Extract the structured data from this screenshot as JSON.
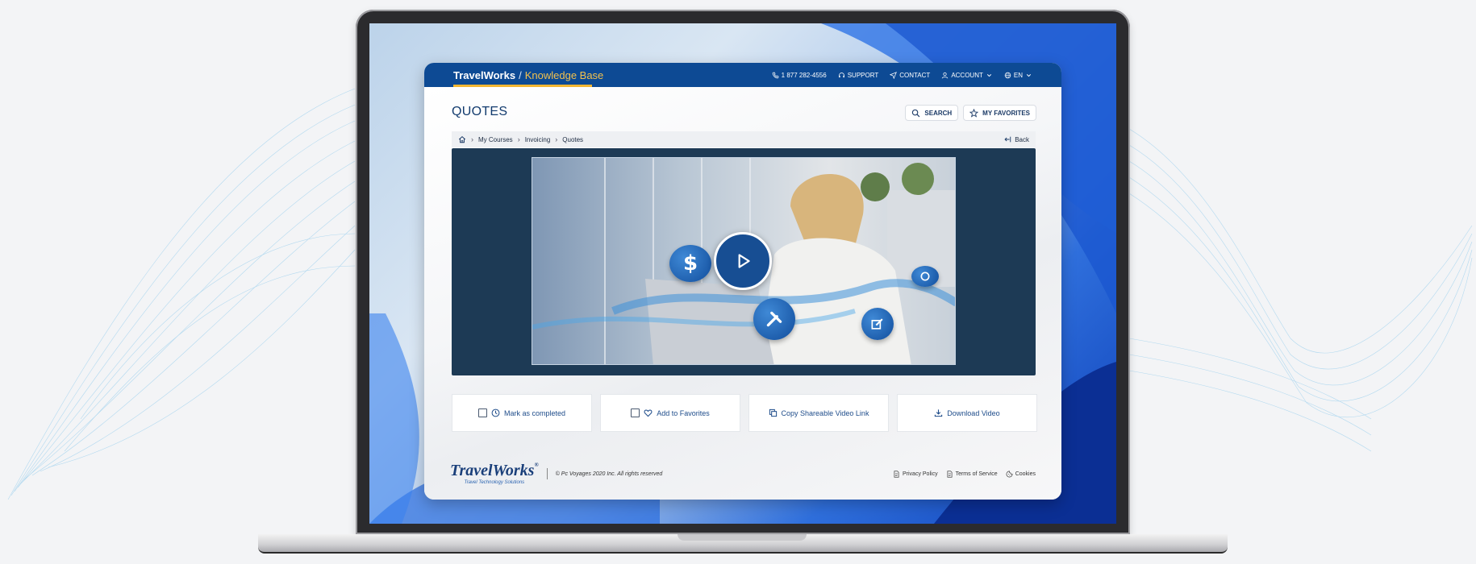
{
  "brand": {
    "name": "TravelWorks",
    "separator": "/",
    "section": "Knowledge Base"
  },
  "topnav": {
    "phone": "1 877 282-4556",
    "support": "SUPPORT",
    "contact": "CONTACT",
    "account": "ACCOUNT",
    "language": "EN"
  },
  "page": {
    "title": "QUOTES"
  },
  "actions": {
    "search": "SEARCH",
    "favorites": "MY FAVORITES"
  },
  "breadcrumb": {
    "items": [
      "My Courses",
      "Invoicing",
      "Quotes"
    ],
    "back": "Back"
  },
  "cards": {
    "completed": "Mark as completed",
    "add_favorites": "Add to Favorites",
    "copy_link": "Copy Shareable Video Link",
    "download": "Download Video"
  },
  "footer": {
    "logo_name": "TravelWorks",
    "logo_tm": "®",
    "logo_tagline": "Travel Technology Solutions",
    "copyright": "© Pc Voyages 2020 Inc. All rights reserved",
    "privacy": "Privacy Policy",
    "terms": "Terms of Service",
    "cookies": "Cookies"
  },
  "colors": {
    "nav_bg": "#0d4a94",
    "accent": "#f2b632",
    "player_bg": "#1d3a55"
  }
}
